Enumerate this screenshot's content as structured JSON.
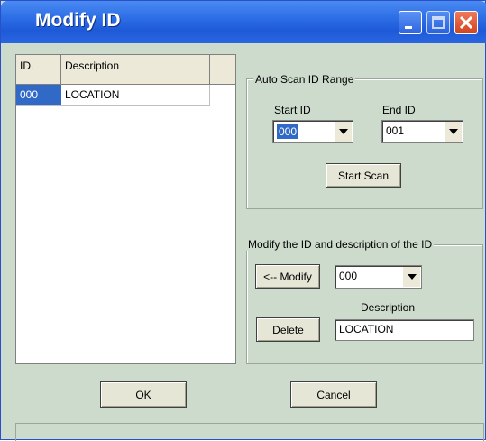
{
  "window": {
    "title": "Modify ID"
  },
  "list": {
    "columns": [
      "ID.",
      "Description"
    ],
    "rows": [
      {
        "id": "000",
        "description": "LOCATION"
      }
    ]
  },
  "auto_scan": {
    "group_label": "Auto Scan ID Range",
    "start_label": "Start ID",
    "end_label": "End ID",
    "start_value": "000",
    "end_value": "001",
    "scan_button": "Start Scan"
  },
  "modify": {
    "group_label": "Modify the ID and description of the ID",
    "modify_button": "<-- Modify",
    "id_value": "000",
    "description_label": "Description",
    "description_value": "LOCATION",
    "delete_button": "Delete"
  },
  "footer": {
    "ok": "OK",
    "cancel": "Cancel"
  },
  "colors": {
    "titlebar": "#2d6ee6",
    "background": "#ccdbcc",
    "selection": "#3169c6",
    "close": "#d2431f"
  },
  "icons": [
    "minimize-icon",
    "maximize-icon",
    "close-icon",
    "chevron-down-icon"
  ]
}
